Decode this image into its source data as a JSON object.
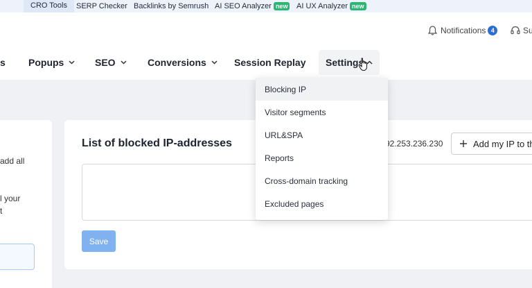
{
  "tools": [
    {
      "label": "CRO Tools",
      "badge": null
    },
    {
      "label": "SERP Checker",
      "badge": null
    },
    {
      "label": "Backlinks by Semrush",
      "badge": null
    },
    {
      "label": "AI SEO Analyzer",
      "badge": "new"
    },
    {
      "label": "AI UX Analyzer",
      "badge": "new"
    }
  ],
  "header": {
    "notifications_label": "Notifications",
    "notifications_count": "4",
    "support_label": "Su"
  },
  "nav": {
    "partial_item": "s",
    "popups": "Popups",
    "seo": "SEO",
    "conversions": "Conversions",
    "session_replay": "Session Replay",
    "settings": "Settings"
  },
  "dropdown": {
    "items": [
      "Blocking IP",
      "Visitor segments",
      "URL&SPA",
      "Reports",
      "Cross-domain tracking",
      "Excluded pages"
    ]
  },
  "left_panel": {
    "line1": "add all",
    "line2": "l your",
    "line3": "t"
  },
  "main": {
    "title": "List of blocked IP-addresses",
    "current_ip": "92.253.236.230",
    "add_ip_button": "Add my IP to the",
    "save_button": "Save"
  },
  "colors": {
    "accent": "#2b6fd6",
    "new_badge": "#2bb673",
    "save_button": "#7fb2ef"
  }
}
